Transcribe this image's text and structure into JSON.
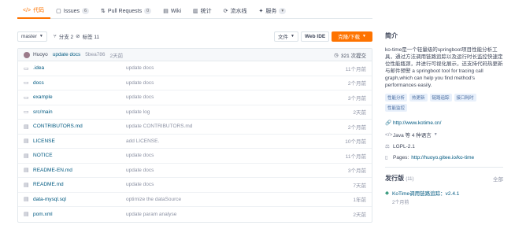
{
  "tabs": [
    {
      "icon": "</>",
      "label": "代码",
      "badge": ""
    },
    {
      "icon": "▢",
      "label": "Issues",
      "badge": "6"
    },
    {
      "icon": "⇅",
      "label": "Pull Requests",
      "badge": "0"
    },
    {
      "icon": "▤",
      "label": "Wiki",
      "badge": ""
    },
    {
      "icon": "▥",
      "label": "统计",
      "badge": ""
    },
    {
      "icon": "⟳",
      "label": "流水线",
      "badge": ""
    },
    {
      "icon": "✦",
      "label": "服务",
      "badge": "▾"
    }
  ],
  "branchbar": {
    "branch": "master",
    "branches_icon": "⑂",
    "branches": "分支 2",
    "tags_icon": "⊘",
    "tags": "标签 11",
    "file_btn": "文件",
    "webide_btn": "Web IDE",
    "clone_btn": "克隆/下载"
  },
  "commit": {
    "author": "Huoyo",
    "message": "update docs",
    "sha": "5bea786",
    "time": "2天前",
    "count": "321 次提交"
  },
  "files": [
    {
      "type": "folder",
      "name": ".idea",
      "message": "update docs",
      "time": "11个月前"
    },
    {
      "type": "folder",
      "name": "docs",
      "message": "update docs",
      "time": "2个月前"
    },
    {
      "type": "folder",
      "name": "example",
      "message": "update docs",
      "time": "3个月前"
    },
    {
      "type": "folder",
      "name": "src/main",
      "message": "update log",
      "time": "2天前"
    },
    {
      "type": "file",
      "name": "CONTRIBUTORS.md",
      "message": "update CONTRIBUTORS.md",
      "time": "2个月前"
    },
    {
      "type": "file",
      "name": "LICENSE",
      "message": "add LICENSE.",
      "time": "10个月前"
    },
    {
      "type": "file",
      "name": "NOTICE",
      "message": "update docs",
      "time": "11个月前"
    },
    {
      "type": "file",
      "name": "README-EN.md",
      "message": "update docs",
      "time": "3个月前"
    },
    {
      "type": "file",
      "name": "README.md",
      "message": "update docs",
      "time": "7天前"
    },
    {
      "type": "file",
      "name": "data-mysql.sql",
      "message": "optimize the dataSource",
      "time": "1年前"
    },
    {
      "type": "file",
      "name": "pom.xml",
      "message": "update param analyse",
      "time": "2天前"
    }
  ],
  "side": {
    "intro_title": "简介",
    "description": "ko-time是一个轻量级的springboot项目性能分析工具，通过方法调用链路追踪以及运行时长监控快速定位性能瓶颈，并进行可视化展示，还支持代码热更新与邮件预警 a springboot tool for tracing call graph,which can help you find method's performances easily.",
    "tags": [
      "性能分析",
      "热更新",
      "链路追踪",
      "接口耗时",
      "性能监控"
    ],
    "website": "http://www.kotime.cn/",
    "languages": "Java 等 4 种语言",
    "license": "LGPL-2.1",
    "pages_label": "Pages:",
    "pages_url": "http://huoyo.gitee.io/ko-time",
    "releases_title": "发行版",
    "releases_count": "(11)",
    "releases_all": "全部",
    "release_name": "KoTime调用链路追踪：v2.4.1",
    "release_time": "2个月前"
  }
}
